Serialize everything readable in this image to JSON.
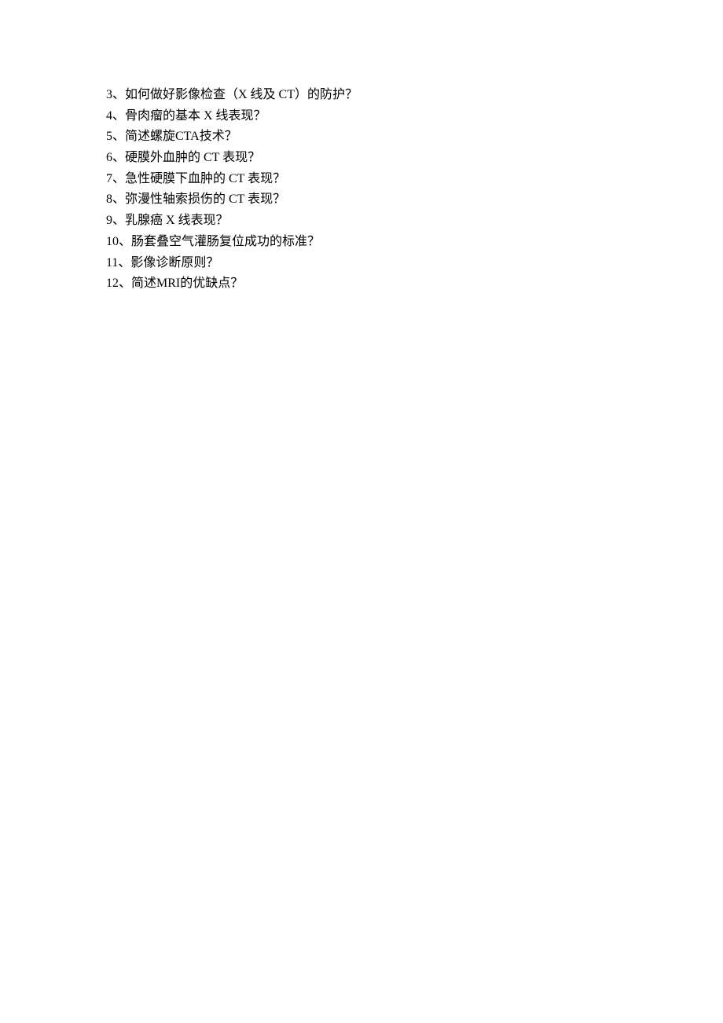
{
  "lines": [
    "3、如何做好影像检查（X 线及 CT）的防护？",
    "4、骨肉瘤的基本 X 线表现？",
    "5、简述螺旋CTA技术？",
    "6、硬膜外血肿的 CT 表现？",
    "7、急性硬膜下血肿的 CT 表现？",
    "8、弥漫性轴索损伤的 CT 表现？",
    "9、乳腺癌  X  线表现？",
    "10、肠套叠空气灌肠复位成功的标准？",
    "11、影像诊断原则？",
    "12、简述MRI的优缺点？"
  ]
}
